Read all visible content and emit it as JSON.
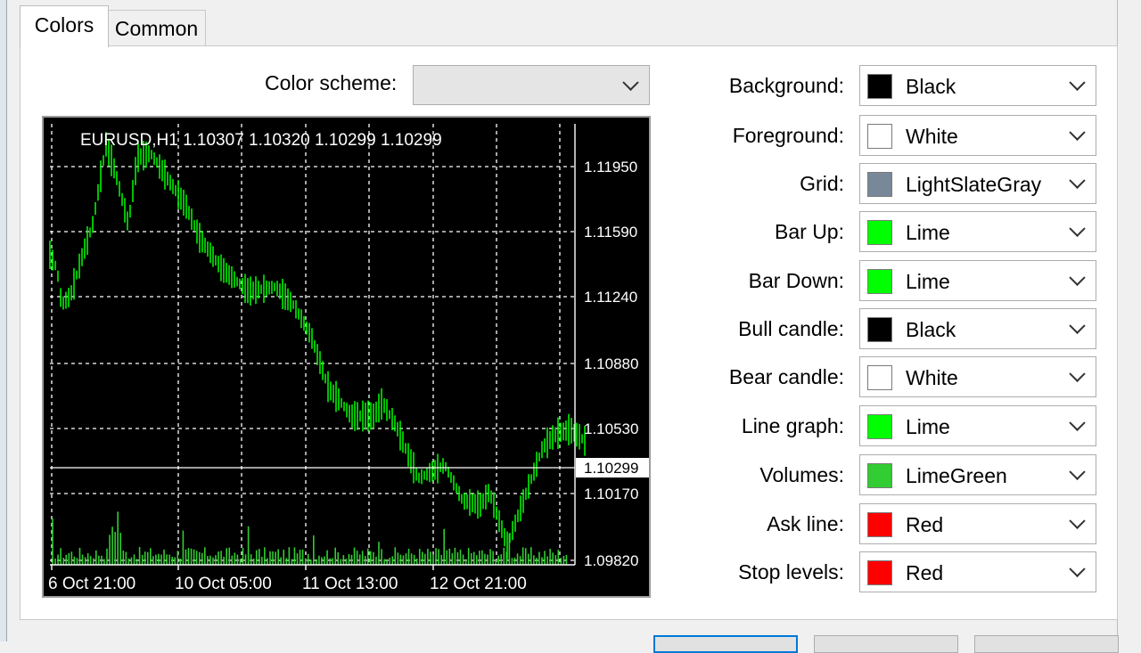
{
  "tabs": [
    {
      "label": "Colors",
      "active": true
    },
    {
      "label": "Common",
      "active": false
    }
  ],
  "color_scheme": {
    "label": "Color scheme:",
    "value": ""
  },
  "chart": {
    "symbol_info": "EURUSD,H1  1.10307 1.10320 1.10299 1.10299",
    "price_levels": [
      "1.11950",
      "1.11590",
      "1.11240",
      "1.10880",
      "1.10530",
      "1.10170",
      "1.09820"
    ],
    "current_price": "1.10299",
    "time_labels": [
      "6 Oct 21:00",
      "10 Oct 05:00",
      "11 Oct 13:00",
      "12 Oct 21:00"
    ],
    "colors": {
      "background": "#000000",
      "foreground": "#ffffff",
      "grid": "#778899",
      "bars": "#00ff00",
      "volumes": "#32cd32"
    }
  },
  "settings": [
    {
      "label": "Background:",
      "color_name": "Black",
      "swatch": "#000000"
    },
    {
      "label": "Foreground:",
      "color_name": "White",
      "swatch": "#ffffff"
    },
    {
      "label": "Grid:",
      "color_name": "LightSlateGray",
      "swatch": "#778899"
    },
    {
      "label": "Bar Up:",
      "color_name": "Lime",
      "swatch": "#00ff00"
    },
    {
      "label": "Bar Down:",
      "color_name": "Lime",
      "swatch": "#00ff00"
    },
    {
      "label": "Bull candle:",
      "color_name": "Black",
      "swatch": "#000000"
    },
    {
      "label": "Bear candle:",
      "color_name": "White",
      "swatch": "#ffffff"
    },
    {
      "label": "Line graph:",
      "color_name": "Lime",
      "swatch": "#00ff00"
    },
    {
      "label": "Volumes:",
      "color_name": "LimeGreen",
      "swatch": "#32cd32"
    },
    {
      "label": "Ask line:",
      "color_name": "Red",
      "swatch": "#ff0000"
    },
    {
      "label": "Stop levels:",
      "color_name": "Red",
      "swatch": "#ff0000"
    }
  ]
}
